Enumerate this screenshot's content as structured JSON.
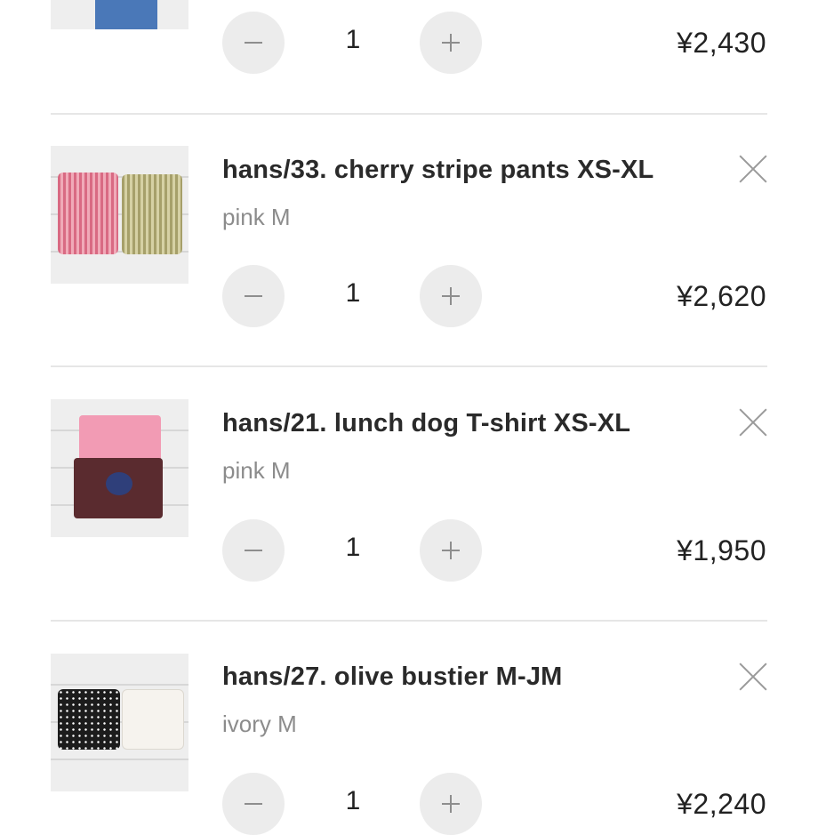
{
  "cart": {
    "items": [
      {
        "title": "",
        "option": "",
        "quantity": "1",
        "price": "¥2,430",
        "thumb_icon": "blue-garment-photo"
      },
      {
        "title": "hans/33. cherry stripe pants XS-XL",
        "option": "pink M",
        "quantity": "1",
        "price": "¥2,620",
        "thumb_icon": "striped-pants-photo"
      },
      {
        "title": "hans/21. lunch dog T-shirt XS-XL",
        "option": "pink M",
        "quantity": "1",
        "price": "¥1,950",
        "thumb_icon": "tshirt-photo"
      },
      {
        "title": "hans/27. olive bustier M-JM",
        "option": "ivory M",
        "quantity": "1",
        "price": "¥2,240",
        "thumb_icon": "bustier-photo"
      }
    ]
  },
  "colors": {
    "stepper_bg": "#ececec",
    "divider": "#e6e6e6",
    "muted_text": "#8c8c8c"
  }
}
